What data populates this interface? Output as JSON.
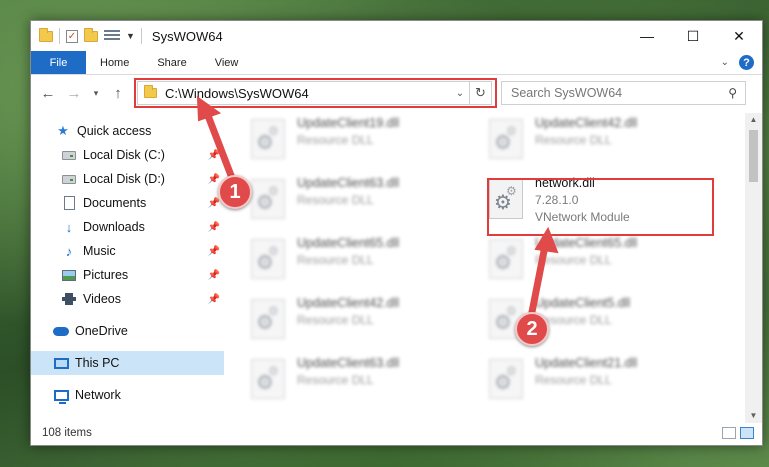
{
  "window": {
    "title": "SysWOW64",
    "controls": {
      "minimize": "—",
      "maximize": "☐",
      "close": "✕"
    }
  },
  "ribbon": {
    "tabs": [
      "File",
      "Home",
      "Share",
      "View"
    ],
    "help": "?"
  },
  "address_bar": {
    "path": "C:\\Windows\\SysWOW64",
    "search_placeholder": "Search SysWOW64"
  },
  "nav_pane": {
    "items": [
      {
        "label": "Quick access",
        "icon": "star-icon",
        "pinned": false
      },
      {
        "label": "Local Disk (C:)",
        "icon": "disk-icon",
        "pinned": true
      },
      {
        "label": "Local Disk (D:)",
        "icon": "disk-icon",
        "pinned": true
      },
      {
        "label": "Documents",
        "icon": "documents-icon",
        "pinned": true
      },
      {
        "label": "Downloads",
        "icon": "downloads-icon",
        "pinned": true
      },
      {
        "label": "Music",
        "icon": "music-icon",
        "pinned": true
      },
      {
        "label": "Pictures",
        "icon": "pictures-icon",
        "pinned": true
      },
      {
        "label": "Videos",
        "icon": "videos-icon",
        "pinned": true
      },
      {
        "label": "OneDrive",
        "icon": "onedrive-icon",
        "pinned": false
      },
      {
        "label": "This PC",
        "icon": "pc-icon",
        "pinned": false,
        "selected": true
      },
      {
        "label": "Network",
        "icon": "network-icon",
        "pinned": false
      }
    ]
  },
  "files": {
    "col1": [
      {
        "name": "UpdateClient19.dll",
        "sub": "Resource DLL"
      },
      {
        "name": "UpdateClient63.dll",
        "sub": "Resource DLL"
      },
      {
        "name": "UpdateClient65.dll",
        "sub": "Resource DLL"
      },
      {
        "name": "UpdateClient42.dll",
        "sub": "Resource DLL"
      },
      {
        "name": "UpdateClient63.dll",
        "sub": "Resource DLL"
      }
    ],
    "col2": [
      {
        "name": "UpdateClient42.dll",
        "sub": "Resource DLL"
      },
      {
        "name": "network.dll",
        "version": "7.28.1.0",
        "sub": "VNetwork Module",
        "highlighted": true
      },
      {
        "name": "UpdateClient65.dll",
        "sub": "Resource DLL"
      },
      {
        "name": "UpdateClient5.dll",
        "sub": "Resource DLL"
      },
      {
        "name": "UpdateClient21.dll",
        "sub": "Resource DLL"
      }
    ]
  },
  "status": {
    "item_count": "108 items"
  },
  "annotations": {
    "marker1": "1",
    "marker2": "2",
    "color": "#e04a4a"
  }
}
